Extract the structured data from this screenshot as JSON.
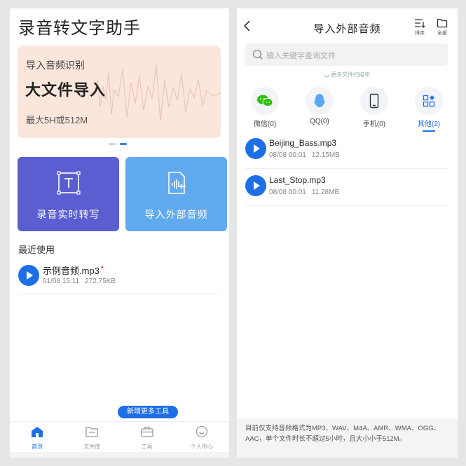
{
  "left": {
    "app_title": "录音转文字助手",
    "banner": {
      "subtitle": "导入音频识别",
      "headline": "大文件导入",
      "note": "最大5H或512M"
    },
    "cards": {
      "record_label": "录音实时转写",
      "import_label": "导入外部音频"
    },
    "recent_title": "最近使用",
    "recent_files": [
      {
        "name": "示例音频.mp3",
        "date": "01/08 15:11",
        "size": "272.75KB",
        "new_dot": "•"
      }
    ],
    "tools_pill": "新增更多工具",
    "tabs": [
      {
        "label": "首页",
        "icon": "home-icon"
      },
      {
        "label": "文件库",
        "icon": "folder-icon"
      },
      {
        "label": "工具",
        "icon": "toolbox-icon"
      },
      {
        "label": "个人中心",
        "icon": "smile-icon"
      }
    ]
  },
  "right": {
    "title": "导入外部音频",
    "actions": {
      "sort_label": "排序",
      "all_label": "全部"
    },
    "search_placeholder": "输入关键字查询文件",
    "scan_text": "更多文件扫描中",
    "sources": [
      {
        "label": "微信(0)",
        "icon": "wechat-icon"
      },
      {
        "label": "QQ(0)",
        "icon": "qq-icon"
      },
      {
        "label": "手机(0)",
        "icon": "phone-icon"
      },
      {
        "label": "其他(2)",
        "icon": "apps-icon"
      }
    ],
    "files": [
      {
        "name": "Beijing_Bass.mp3",
        "date": "08/08 00:01",
        "size": "12.15MB"
      },
      {
        "name": "Last_Stop.mp3",
        "date": "08/08 00:01",
        "size": "11.28MB"
      }
    ],
    "footer_note": "目前仅支持音频格式为MP3、WAV、M4A、AMR、WMA、OGG、AAC，单个文件时长不超过5小时，且大小小于512M。"
  },
  "colors": {
    "accent": "#1e6fe6",
    "record_card": "#5b5ed1",
    "import_card": "#62aaf0",
    "banner_bg": "#fbe6dc"
  }
}
